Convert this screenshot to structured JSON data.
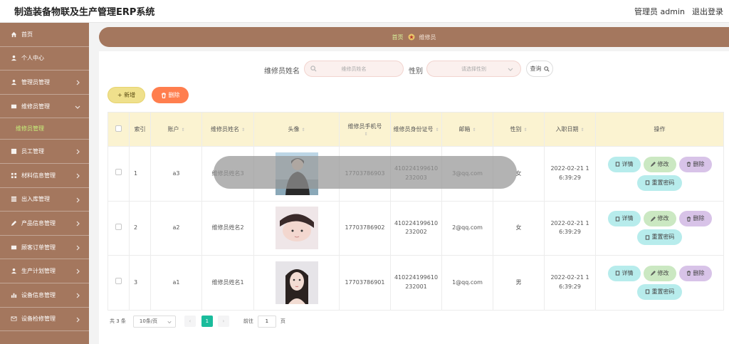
{
  "app": {
    "title": "制造装备物联及生产管理ERP系统",
    "user": "管理员 admin",
    "logout": "退出登录"
  },
  "sidebar": {
    "items": [
      {
        "label": "首页",
        "icon": "home-icon"
      },
      {
        "label": "个人中心",
        "icon": "user-icon"
      },
      {
        "label": "管理员管理",
        "icon": "user-icon"
      },
      {
        "label": "维修员管理",
        "icon": "grid-icon",
        "expanded": true,
        "sub": "维修员管理"
      },
      {
        "label": "员工管理",
        "icon": "list-icon"
      },
      {
        "label": "材料信息管理",
        "icon": "grid-icon"
      },
      {
        "label": "出入库管理",
        "icon": "list-icon"
      },
      {
        "label": "产品信息管理",
        "icon": "pen-icon"
      },
      {
        "label": "顾客订单管理",
        "icon": "grid-icon"
      },
      {
        "label": "生产计划管理",
        "icon": "user-icon"
      },
      {
        "label": "设备信息管理",
        "icon": "chart-icon"
      },
      {
        "label": "设备检修管理",
        "icon": "mail-icon"
      }
    ]
  },
  "breadcrumb": {
    "home": "首页",
    "current": "维修员"
  },
  "search": {
    "name_label": "维修员姓名",
    "name_placeholder": "维修员姓名",
    "gender_label": "性别",
    "gender_placeholder": "请选择性别",
    "query_label": "查询"
  },
  "toolbar": {
    "add_label": "+ 新增",
    "delete_label": "删除"
  },
  "table": {
    "headers": [
      "",
      "索引",
      "账户",
      "维修员姓名",
      "头像",
      "维修员手机号",
      "维修员身份证号",
      "邮箱",
      "性别",
      "入职日期",
      "操作"
    ],
    "rows": [
      {
        "index": "1",
        "account": "a3",
        "name": "维修员姓名3",
        "phone": "17703786903",
        "id_card_1": "410224199610",
        "id_card_2": "232003",
        "email": "3@qq.com",
        "gender": "女",
        "date_1": "2022-02-21 1",
        "date_2": "6:39:29"
      },
      {
        "index": "2",
        "account": "a2",
        "name": "维修员姓名2",
        "phone": "17703786902",
        "id_card_1": "410224199610",
        "id_card_2": "232002",
        "email": "2@qq.com",
        "gender": "女",
        "date_1": "2022-02-21 1",
        "date_2": "6:39:29"
      },
      {
        "index": "3",
        "account": "a1",
        "name": "维修员姓名1",
        "phone": "17703786901",
        "id_card_1": "410224199610",
        "id_card_2": "232001",
        "email": "1@qq.com",
        "gender": "男",
        "date_1": "2022-02-21 1",
        "date_2": "6:39:29"
      }
    ],
    "ops": {
      "detail": "详情",
      "edit": "修改",
      "delete": "删除",
      "reset": "重置密码"
    }
  },
  "pagination": {
    "total": "共 3 条",
    "page_size": "10条/页",
    "current_page": "1",
    "goto_label": "前往",
    "goto_value": "1",
    "page_suffix": "页"
  },
  "colors": {
    "sidebar": "#a4775e",
    "header_row": "#fbf3d1",
    "add_button": "#efe08c",
    "delete_button": "#ff7e4e",
    "page_active": "#1abc9c"
  }
}
